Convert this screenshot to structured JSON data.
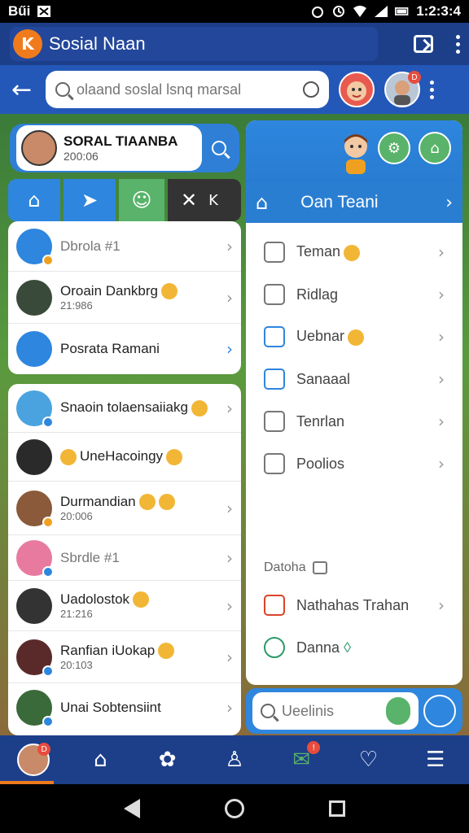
{
  "status_bar": {
    "left_text": "Bűi",
    "time": "1:2:3:4"
  },
  "app_bar": {
    "logo_letter": "K",
    "title": "Sosial Naan"
  },
  "search": {
    "placeholder": "olaand soslal lsnq marsal"
  },
  "profile": {
    "name": "SORAL TIAANBA",
    "subtitle": "200:06"
  },
  "tabs": {
    "more_label": "K"
  },
  "list1": [
    {
      "title": "Dbrola #1",
      "muted": true
    },
    {
      "title": "Oroain Dankbrg",
      "subtitle": "21:986"
    },
    {
      "title": "Posrata Ramani"
    }
  ],
  "list2": [
    {
      "title": "Snaoin tolaensaiiakg"
    },
    {
      "title": "UneHacoingy"
    },
    {
      "title": "Durmandian",
      "subtitle": "20:006"
    },
    {
      "title": "Sbrdle #1",
      "muted": true
    },
    {
      "title": "Uadolostok",
      "subtitle": "21:216"
    },
    {
      "title": "Ranfian iUokap",
      "subtitle": "20:103"
    },
    {
      "title": "Unai Sobtensiint"
    }
  ],
  "right_panel": {
    "nav_label": "Oan Teani",
    "menu": [
      {
        "label": "Teman",
        "icon": "clock-icon"
      },
      {
        "label": "Ridlag",
        "icon": "edit-icon"
      },
      {
        "label": "Uebnar",
        "icon": "chart-icon"
      },
      {
        "label": "Sanaaal",
        "icon": "photo-icon"
      },
      {
        "label": "Tenrlan",
        "icon": "list-icon"
      },
      {
        "label": "Poolios",
        "icon": "folder-icon"
      }
    ],
    "section_label": "Datoha",
    "extra": [
      {
        "label": "Nathahas Trahan",
        "icon": "calendar-icon"
      },
      {
        "label": "Danna",
        "icon": "whatsapp-icon"
      }
    ]
  },
  "bottom_search": {
    "placeholder": "Ueelinis"
  },
  "bottom_nav": [
    {
      "name": "profile",
      "icon": "avatar"
    },
    {
      "name": "home",
      "icon": "home-icon"
    },
    {
      "name": "groups",
      "icon": "puzzle-icon"
    },
    {
      "name": "friends",
      "icon": "user-icon"
    },
    {
      "name": "mail",
      "icon": "mail-icon"
    },
    {
      "name": "favorites",
      "icon": "heart-icon"
    },
    {
      "name": "menu",
      "icon": "menu-icon"
    }
  ],
  "colors": {
    "primary": "#1d3f8a",
    "accent": "#2e86de",
    "green": "#59b36a",
    "orange": "#f07b1d"
  }
}
